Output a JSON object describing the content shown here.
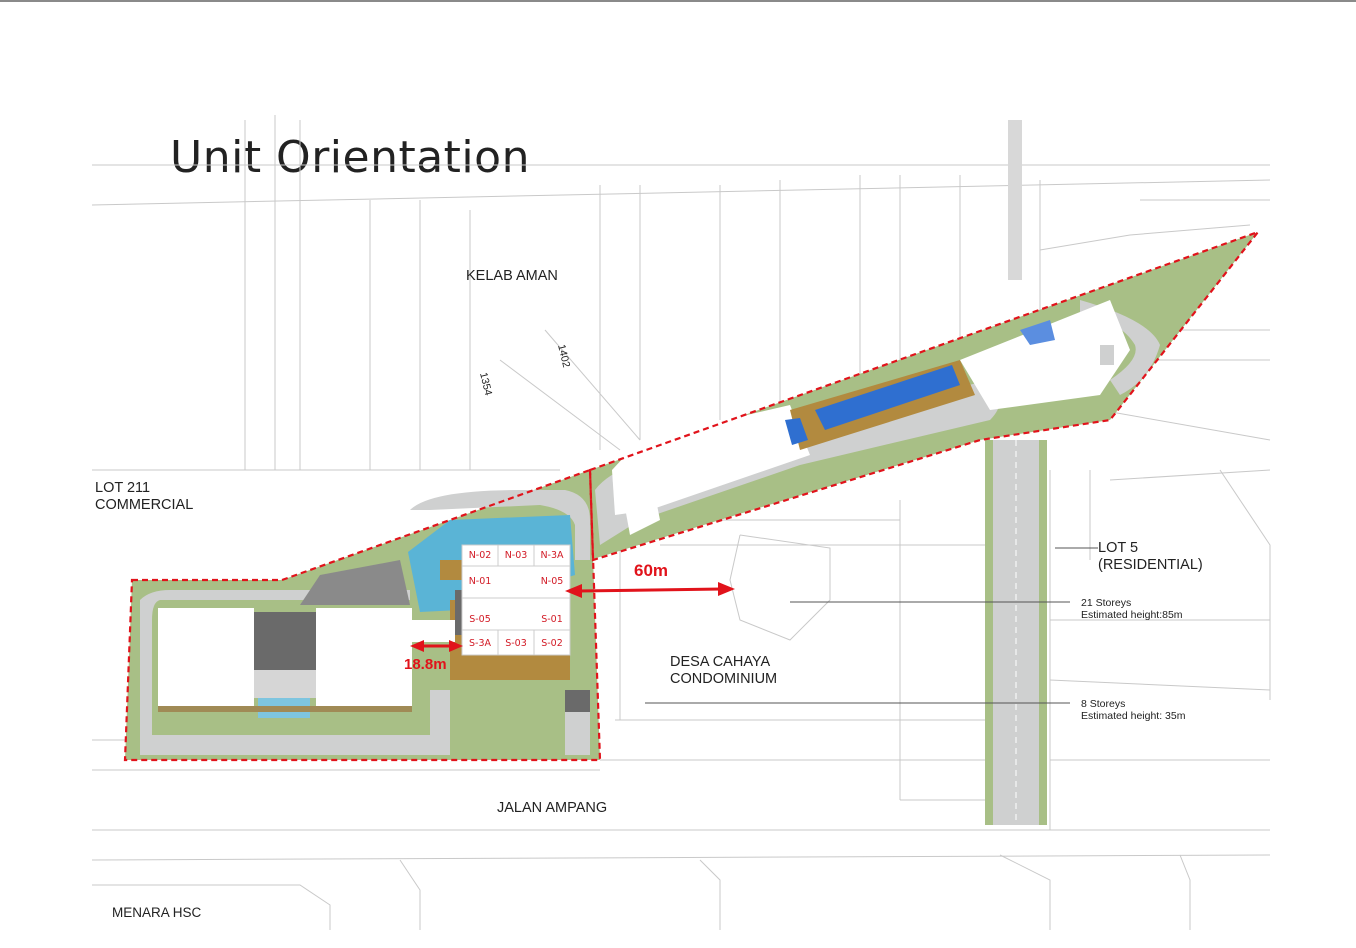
{
  "title": "Unit Orientation",
  "labels": {
    "kelab_aman": "KELAB AMAN",
    "lot211": "LOT 211\nCOMMERCIAL",
    "lot5": "LOT 5\n(RESIDENTIAL)",
    "desa_cahaya": "DESA CAHAYA\nCONDOMINIUM",
    "jalan_ampang": "JALAN AMPANG",
    "menara_hsc": "MENARA HSC",
    "storeys21": "21 Storeys\nEstimated height:85m",
    "storeys8": "8 Storeys\nEstimated height: 35m",
    "dim1": "1354",
    "dim2": "1402"
  },
  "distances": {
    "d60": "60m",
    "d18": "18.8m"
  },
  "units": {
    "n02": "N-02",
    "n03": "N-03",
    "n3a": "N-3A",
    "n01": "N-01",
    "n05": "N-05",
    "s05": "S-05",
    "s01": "S-01",
    "s3a": "S-3A",
    "s03": "S-03",
    "s02": "S-02"
  },
  "colors": {
    "boundary": "#e1131b",
    "landscape": "#a8bf86",
    "road": "#cfd0d0",
    "water": "#5ab4d6",
    "roof_blue": "#2f6fd0",
    "timber": "#b28a3f"
  }
}
